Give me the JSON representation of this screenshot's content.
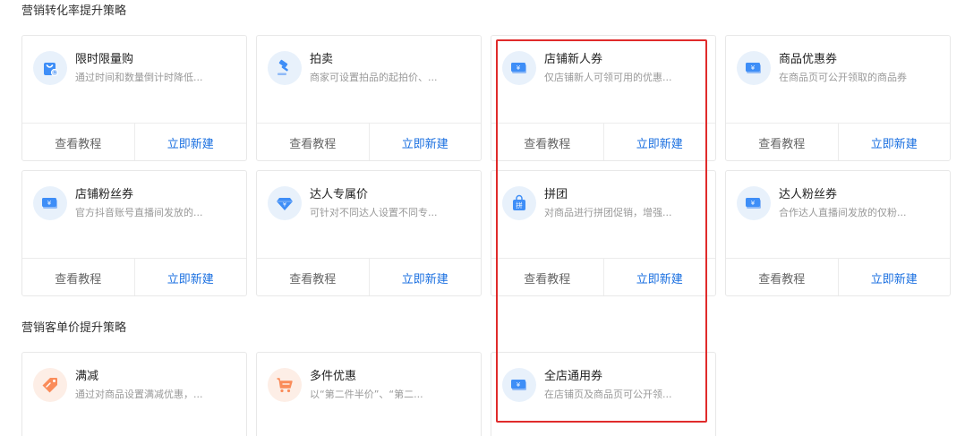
{
  "sections": {
    "conversion": {
      "title": "营销转化率提升策略"
    },
    "unit_price": {
      "title": "营销客单价提升策略"
    }
  },
  "footer": {
    "tutorial_label": "查看教程",
    "create_label": "立即新建"
  },
  "colors": {
    "accent_blue": "#1a6fe0",
    "icon_blue": "#3e8ef7",
    "icon_blue_bg": "#e8f1fb",
    "icon_orange": "#fa8c5a",
    "icon_orange_bg": "#fdeee6",
    "highlight_red": "#e02b2b"
  },
  "cards": {
    "limited_purchase": {
      "title": "限时限量购",
      "desc": "通过时间和数量倒计时降低...",
      "icon": "flash-sale-bag-icon"
    },
    "auction": {
      "title": "拍卖",
      "desc": "商家可设置拍品的起拍价、...",
      "icon": "auction-gavel-icon"
    },
    "new_customer_coupon": {
      "title": "店铺新人券",
      "desc": "仅店铺新人可领可用的优惠...",
      "icon": "coupon-icon"
    },
    "product_coupon": {
      "title": "商品优惠券",
      "desc": "在商品页可公开领取的商品券",
      "icon": "coupon-icon"
    },
    "fan_coupon": {
      "title": "店铺粉丝券",
      "desc": "官方抖音账号直播间发放的...",
      "icon": "coupon-icon"
    },
    "influencer_price": {
      "title": "达人专属价",
      "desc": "可针对不同达人设置不同专...",
      "icon": "diamond-price-icon"
    },
    "group_buy": {
      "title": "拼团",
      "desc": "对商品进行拼团促销，增强...",
      "icon": "group-buy-bag-icon"
    },
    "influencer_fan_coupon": {
      "title": "达人粉丝券",
      "desc": "合作达人直播间发放的仅粉...",
      "icon": "coupon-icon"
    },
    "full_reduction": {
      "title": "满减",
      "desc": "通过对商品设置满减优惠，...",
      "icon": "price-tag-icon"
    },
    "multi_item_discount": {
      "title": "多件优惠",
      "desc": "以“第二件半价”、“第二...",
      "icon": "shopping-cart-icon"
    },
    "store_wide_coupon": {
      "title": "全店通用券",
      "desc": "在店铺页及商品页可公开领...",
      "icon": "coupon-icon"
    }
  }
}
